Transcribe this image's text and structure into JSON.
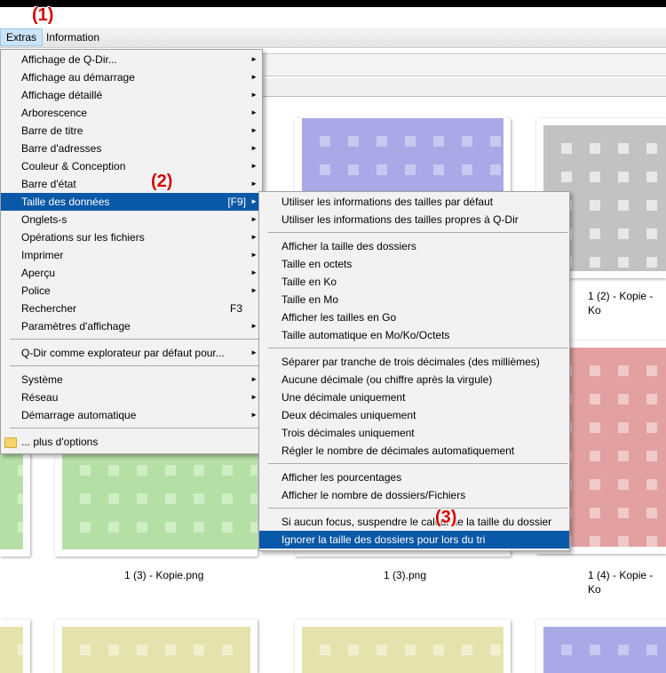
{
  "menubar": {
    "items": [
      "Extras",
      "Information"
    ]
  },
  "badges": [
    "(1)",
    "(2)",
    "(3)"
  ],
  "extras_menu": {
    "items": [
      {
        "label": "Affichage de Q-Dir...",
        "submenu": true
      },
      {
        "label": "Affichage au démarrage",
        "submenu": true
      },
      {
        "label": "Affichage détaillé",
        "submenu": true
      },
      {
        "label": "Arborescence",
        "submenu": true
      },
      {
        "label": "Barre de titre",
        "submenu": true
      },
      {
        "label": "Barre d'adresses",
        "submenu": true
      },
      {
        "label": "Couleur & Conception",
        "submenu": true
      },
      {
        "label": "Barre d'état",
        "submenu": true
      },
      {
        "label": "Taille des données",
        "shortcut": "[F9]",
        "submenu": true,
        "highlighted": true
      },
      {
        "label": "Onglets-s",
        "submenu": true
      },
      {
        "label": "Opérations sur les fichiers",
        "submenu": true
      },
      {
        "label": "Imprimer",
        "submenu": true
      },
      {
        "label": "Aperçu",
        "submenu": true
      },
      {
        "label": "Police",
        "submenu": true
      },
      {
        "label": "Rechercher",
        "shortcut": "F3"
      },
      {
        "label": "Paramètres d'affichage",
        "submenu": true
      },
      {
        "label": "Q-Dir comme explorateur par défaut pour...",
        "submenu": true
      },
      {
        "label": "Système",
        "submenu": true
      },
      {
        "label": "Réseau",
        "submenu": true
      },
      {
        "label": "Démarrage automatique",
        "submenu": true
      },
      {
        "label": "... plus d'options",
        "icon": "folder-icon"
      }
    ]
  },
  "size_submenu": {
    "items": [
      "Utiliser les informations des tailles par défaut",
      "Utiliser les informations des tailles propres à Q-Dir",
      "Afficher la taille des dossiers",
      "Taille en octets",
      "Taille en Ko",
      "Taille en Mo",
      "Afficher les tailles en Go",
      "Taille automatique en Mo/Ko/Octets",
      "Séparer par tranche de trois décimales (des millièmes)",
      "Aucune décimale (ou chiffre après la virgule)",
      "Une décimale uniquement",
      "Deux décimales uniquement",
      "Trois décimales uniquement",
      "Régler le nombre de décimales automatiquement",
      "Afficher les pourcentages",
      "Afficher le nombre de dossiers/Fichiers",
      "Si aucun focus, suspendre le calcul de la taille du dossier",
      "Ignorer la taille des dossiers pour lors du tri"
    ],
    "highlighted_index": 17
  },
  "thumbnails": {
    "captions": [
      "1 (2) - Kopie - Ko",
      "1 (3) - Kopie.png",
      "1 (3).png",
      "1 (4) - Kopie - Ko"
    ],
    "colors": {
      "blue": "#a9a9e8",
      "grey": "#cfcfcf",
      "red": "#eaabab",
      "green": "#b4e0a6",
      "yellow": "#e6e2ad"
    }
  },
  "colors": {
    "highlight": "#0a58a8",
    "badge": "#d40000",
    "menu_bg": "#f2f2f2"
  }
}
